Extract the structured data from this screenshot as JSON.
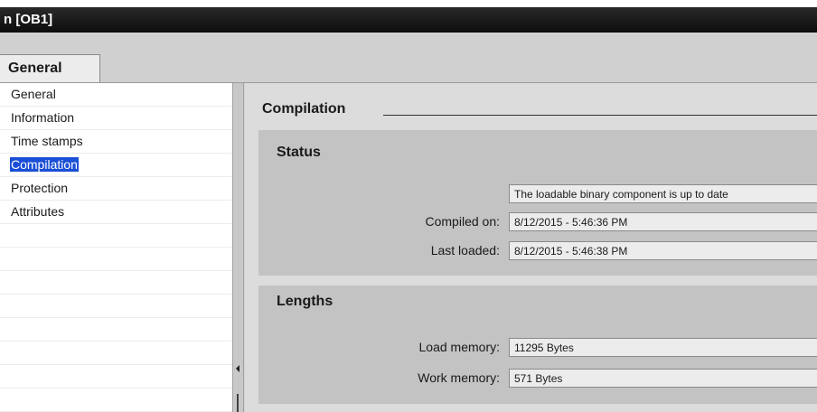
{
  "window": {
    "title": "n [OB1]"
  },
  "tabs": [
    {
      "label": "General"
    }
  ],
  "nav": {
    "items": [
      {
        "label": "General"
      },
      {
        "label": "Information"
      },
      {
        "label": "Time stamps"
      },
      {
        "label": "Compilation",
        "selected": true
      },
      {
        "label": "Protection"
      },
      {
        "label": "Attributes"
      }
    ]
  },
  "compilation": {
    "heading": "Compilation",
    "status": {
      "title": "Status",
      "message": "The loadable binary component is up to date",
      "compiled_on_label": "Compiled on:",
      "compiled_on_value": "8/12/2015 - 5:46:36 PM",
      "last_loaded_label": "Last loaded:",
      "last_loaded_value": "8/12/2015 - 5:46:38 PM"
    },
    "lengths": {
      "title": "Lengths",
      "load_memory_label": "Load memory:",
      "load_memory_value": "11295 Bytes",
      "work_memory_label": "Work memory:",
      "work_memory_value": "571 Bytes"
    }
  },
  "colors": {
    "selection": "#1a4fd6",
    "titlebar": "#111111",
    "group_background": "#c3c3c3"
  }
}
